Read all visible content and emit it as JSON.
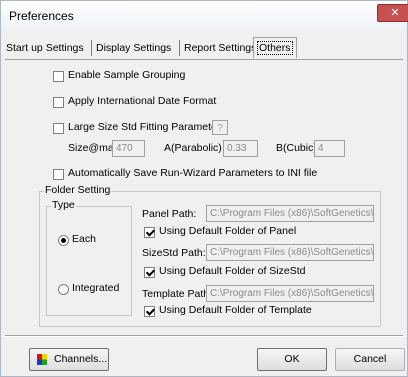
{
  "window": {
    "title": "Preferences",
    "close_glyph": "✕"
  },
  "tabs": [
    {
      "label": "Start up Settings"
    },
    {
      "label": "Display Settings"
    },
    {
      "label": "Report Settings"
    },
    {
      "label": "Others",
      "active": true
    }
  ],
  "options": {
    "enable_sample_grouping": {
      "label": "Enable Sample Grouping",
      "checked": false
    },
    "apply_international_date": {
      "label": "Apply International Date Format",
      "checked": false
    },
    "large_size_std": {
      "label": "Large Size Std Fitting Parameters",
      "checked": false,
      "help_label": "?"
    },
    "size_max": {
      "label": "Size@max",
      "value": "470"
    },
    "a_parabolic": {
      "label": "A(Parabolic)",
      "value": "0.33"
    },
    "b_cubic": {
      "label": "B(Cubic)",
      "value": "4"
    },
    "auto_save_runwizard": {
      "label": "Automatically Save Run-Wizard Parameters to INI file",
      "checked": false
    }
  },
  "folder_setting": {
    "label": "Folder Setting",
    "type_label": "Type",
    "type_options": [
      {
        "label": "Each",
        "selected": true
      },
      {
        "label": "Integrated",
        "selected": false
      }
    ],
    "panel_path": {
      "label": "Panel Path:",
      "value": "C:\\Program Files (x86)\\SoftGenetics\\G",
      "default_label": "Using Default Folder of Panel",
      "default_checked": true
    },
    "sizestd_path": {
      "label": "SizeStd Path:",
      "value": "C:\\Program Files (x86)\\SoftGenetics\\G",
      "default_label": "Using Default Folder of SizeStd",
      "default_checked": true
    },
    "template_path": {
      "label": "Template Path:",
      "value": "C:\\Program Files (x86)\\SoftGenetics\\G",
      "default_label": "Using Default Folder of Template",
      "default_checked": true
    }
  },
  "buttons": {
    "channels": "Channels...",
    "ok": "OK",
    "cancel": "Cancel"
  },
  "colors": {
    "close_button": "#c75050",
    "channels_icon": [
      "#e01010",
      "#f0d000",
      "#1040c0",
      "#20a020"
    ]
  }
}
